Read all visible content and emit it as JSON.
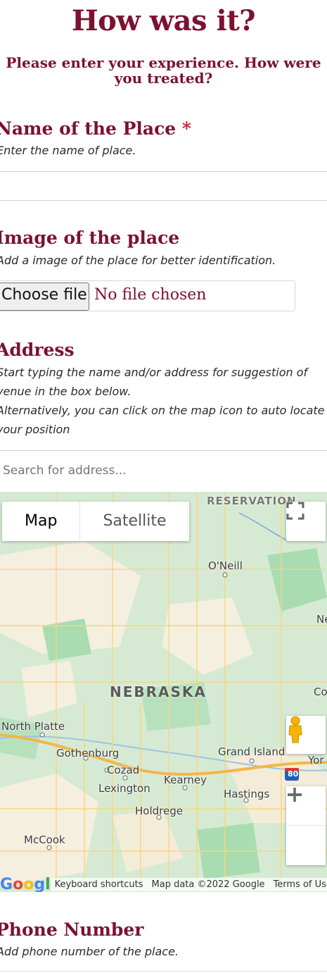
{
  "header": {
    "title": "How was it?",
    "subtitle": "Please enter your experience. How were you treated?"
  },
  "fields": {
    "name": {
      "label": "Name of the Place",
      "required_mark": "*",
      "help": "Enter the name of place."
    },
    "image": {
      "label": "Image of the place",
      "help": "Add a image of the place for better identification.",
      "button": "Choose file",
      "status": "No file chosen"
    },
    "address": {
      "label": "Address",
      "help_1": "Start typing the name and/or address for suggestion of",
      "help_2": "venue in the box below.",
      "help_3": "Alternatively, you can click on the map icon to auto locate",
      "help_4": "your position",
      "placeholder": "Search for address..."
    },
    "phone": {
      "label": "Phone Number",
      "help": "Add phone number of the place."
    }
  },
  "map": {
    "type_map": "Map",
    "type_satellite": "Satellite",
    "state_label": "NEBRASKA",
    "top_label": "RESERVATION",
    "places": [
      "O'Neill",
      "North Platte",
      "Gothenburg",
      "Cozad",
      "Lexington",
      "Kearney",
      "Grand Island",
      "Hastings",
      "Holdrege",
      "McCook",
      "Yor",
      "Co",
      "Ne"
    ],
    "interstate": "80",
    "footer": {
      "logo": "Google",
      "shortcuts": "Keyboard shortcuts",
      "data": "Map data ©2022 Google",
      "terms": "Terms of Use"
    },
    "colors": {
      "land": "#d6ead3",
      "forest": "#a9dcb1",
      "road": "#f7d77a",
      "highway": "#f2b64a"
    }
  },
  "colors": {
    "accent": "#7b1230",
    "required": "#c41e3a"
  }
}
